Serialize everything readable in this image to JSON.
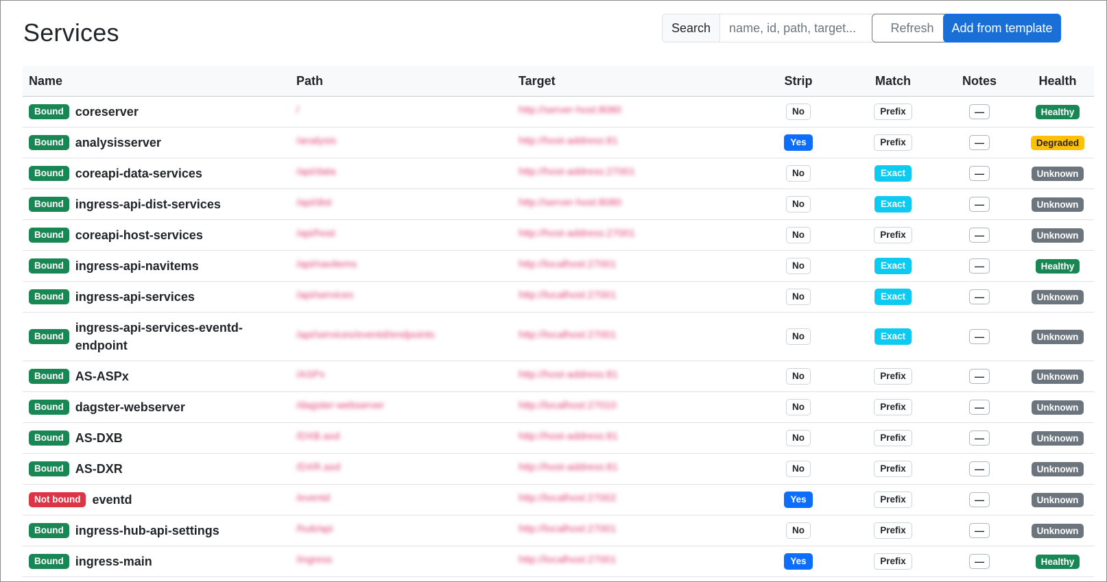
{
  "page": {
    "title": "Services"
  },
  "toolbar": {
    "search_label": "Search",
    "search_placeholder": "name, id, path, target...",
    "search_value": "",
    "refresh_label": "Refresh",
    "add_label": "Add from template"
  },
  "table": {
    "headers": {
      "name": "Name",
      "path": "Path",
      "target": "Target",
      "strip": "Strip",
      "match": "Match",
      "notes": "Notes",
      "health": "Health"
    },
    "rows": [
      {
        "status": "Bound",
        "name": "coreserver",
        "path": "/",
        "target": "http://server-host:8080",
        "strip": "No",
        "match": "Prefix",
        "notes": "—",
        "health": "Healthy"
      },
      {
        "status": "Bound",
        "name": "analysisserver",
        "path": "/analysis",
        "target": "http://host-address:81",
        "strip": "Yes",
        "match": "Prefix",
        "notes": "—",
        "health": "Degraded"
      },
      {
        "status": "Bound",
        "name": "coreapi-data-services",
        "path": "/api/data",
        "target": "http://host-address:27001",
        "strip": "No",
        "match": "Exact",
        "notes": "—",
        "health": "Unknown"
      },
      {
        "status": "Bound",
        "name": "ingress-api-dist-services",
        "path": "/api/dist",
        "target": "http://server-host:8080",
        "strip": "No",
        "match": "Exact",
        "notes": "—",
        "health": "Unknown"
      },
      {
        "status": "Bound",
        "name": "coreapi-host-services",
        "path": "/api/host",
        "target": "http://host-address:27001",
        "strip": "No",
        "match": "Prefix",
        "notes": "—",
        "health": "Unknown"
      },
      {
        "status": "Bound",
        "name": "ingress-api-navitems",
        "path": "/api/navitems",
        "target": "http://localhost:27001",
        "strip": "No",
        "match": "Exact",
        "notes": "—",
        "health": "Healthy"
      },
      {
        "status": "Bound",
        "name": "ingress-api-services",
        "path": "/api/services",
        "target": "http://localhost:27001",
        "strip": "No",
        "match": "Exact",
        "notes": "—",
        "health": "Unknown"
      },
      {
        "status": "Bound",
        "name": "ingress-api-services-eventd-endpoint",
        "path": "/api/services/eventd/endpoints",
        "target": "http://localhost:27001",
        "strip": "No",
        "match": "Exact",
        "notes": "—",
        "health": "Unknown"
      },
      {
        "status": "Bound",
        "name": "AS-ASPx",
        "path": "/ASPx",
        "target": "http://host-address:81",
        "strip": "No",
        "match": "Prefix",
        "notes": "—",
        "health": "Unknown"
      },
      {
        "status": "Bound",
        "name": "dagster-webserver",
        "path": "/dagster-webserver",
        "target": "http://localhost:27010",
        "strip": "No",
        "match": "Prefix",
        "notes": "—",
        "health": "Unknown"
      },
      {
        "status": "Bound",
        "name": "AS-DXB",
        "path": "/DXB.axd",
        "target": "http://host-address:81",
        "strip": "No",
        "match": "Prefix",
        "notes": "—",
        "health": "Unknown"
      },
      {
        "status": "Bound",
        "name": "AS-DXR",
        "path": "/DXR.axd",
        "target": "http://host-address:81",
        "strip": "No",
        "match": "Prefix",
        "notes": "—",
        "health": "Unknown"
      },
      {
        "status": "Not bound",
        "name": "eventd",
        "path": "/eventd",
        "target": "http://localhost:27002",
        "strip": "Yes",
        "match": "Prefix",
        "notes": "—",
        "health": "Unknown"
      },
      {
        "status": "Bound",
        "name": "ingress-hub-api-settings",
        "path": "/hub/api",
        "target": "http://localhost:27001",
        "strip": "No",
        "match": "Prefix",
        "notes": "—",
        "health": "Unknown"
      },
      {
        "status": "Bound",
        "name": "ingress-main",
        "path": "/ingress",
        "target": "http://localhost:27001",
        "strip": "Yes",
        "match": "Prefix",
        "notes": "—",
        "health": "Healthy"
      }
    ]
  },
  "colors": {
    "primary": "#1a6fd6",
    "bound": "#198754",
    "not_bound": "#dc3545",
    "exact": "#0dcaf0",
    "degraded": "#ffc107",
    "unknown": "#6c757d"
  }
}
